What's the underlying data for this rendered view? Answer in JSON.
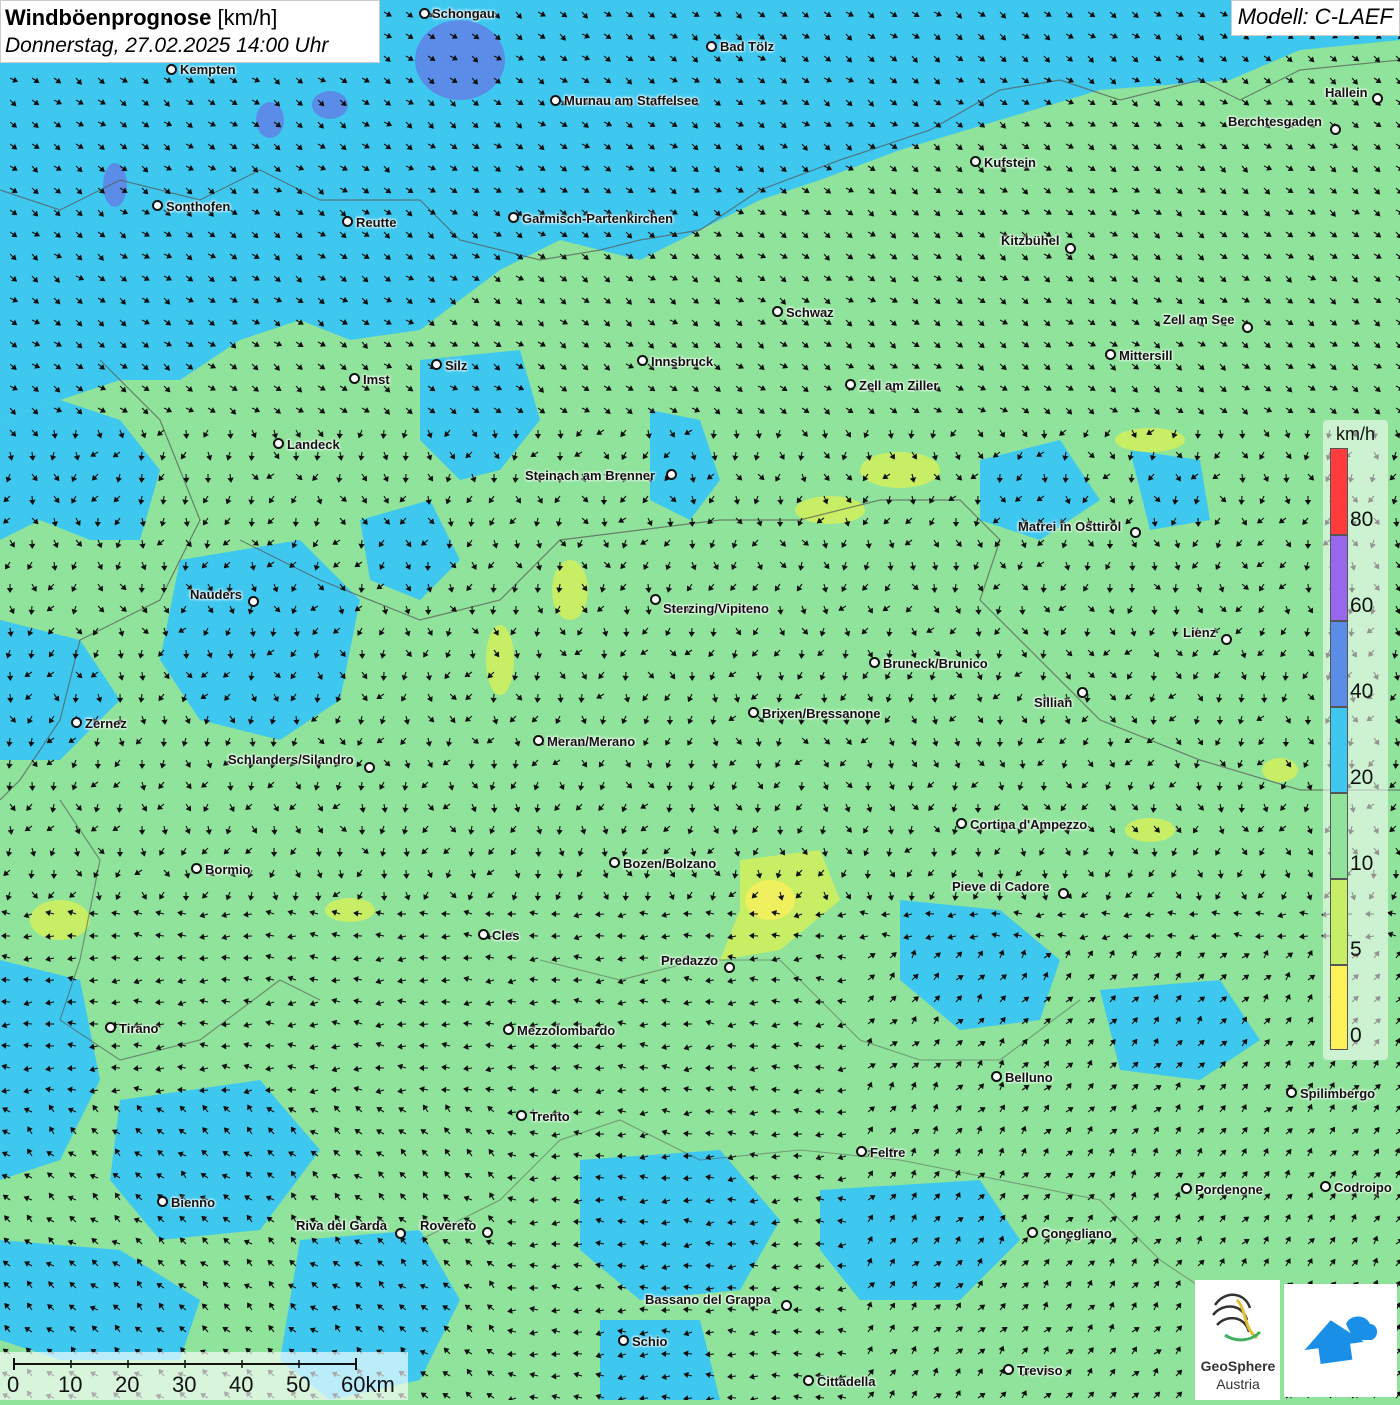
{
  "title": {
    "main": "Windböenprognose",
    "unit": "[km/h]",
    "date": "Donnerstag, 27.02.2025 14:00 Uhr"
  },
  "model": "Modell: C-LAEF",
  "legend": {
    "unit": "km/h",
    "labels": [
      "80",
      "60",
      "40",
      "20",
      "10",
      "5",
      "0"
    ],
    "colors": {
      "c80": "#ff3b3b",
      "c60": "#9966ee",
      "c40": "#5b8de8",
      "c20": "#3ec8f0",
      "c10": "#8fe39a",
      "c5": "#c8ee66",
      "c0": "#fff15a"
    }
  },
  "scale": {
    "labels": [
      "0",
      "10",
      "20",
      "30",
      "40",
      "50",
      "60km"
    ]
  },
  "logos": {
    "geosphere_line1": "GeoSphere",
    "geosphere_line2": "Austria"
  },
  "cities": [
    {
      "name": "Schongau"
    },
    {
      "name": "Bad Tölz"
    },
    {
      "name": "Kempten"
    },
    {
      "name": "Murnau am Staffelsee"
    },
    {
      "name": "Hallein"
    },
    {
      "name": "Berchtesgaden"
    },
    {
      "name": "Kufstein"
    },
    {
      "name": "Sonthofen"
    },
    {
      "name": "Reutte"
    },
    {
      "name": "Garmisch-Partenkirchen"
    },
    {
      "name": "Kitzbühel"
    },
    {
      "name": "Schwaz"
    },
    {
      "name": "Zell am See"
    },
    {
      "name": "Mittersill"
    },
    {
      "name": "Innsbruck"
    },
    {
      "name": "Imst"
    },
    {
      "name": "Silz"
    },
    {
      "name": "Zell am Ziller"
    },
    {
      "name": "Landeck"
    },
    {
      "name": "Steinach am Brenner"
    },
    {
      "name": "Matrei in Osttirol"
    },
    {
      "name": "Nauders"
    },
    {
      "name": "Sterzing/Vipiteno"
    },
    {
      "name": "Lienz"
    },
    {
      "name": "Bruneck/Brunico"
    },
    {
      "name": "Sillian"
    },
    {
      "name": "Zernez"
    },
    {
      "name": "Brixen/Bressanone"
    },
    {
      "name": "Meran/Merano"
    },
    {
      "name": "Schlanders/Silandro"
    },
    {
      "name": "Cortina d'Ampezzo"
    },
    {
      "name": "Bormio"
    },
    {
      "name": "Bozen/Bolzano"
    },
    {
      "name": "Pieve di Cadore"
    },
    {
      "name": "Cles"
    },
    {
      "name": "Predazzo"
    },
    {
      "name": "Tirano"
    },
    {
      "name": "Mezzolombardo"
    },
    {
      "name": "Belluno"
    },
    {
      "name": "Spilimbergo"
    },
    {
      "name": "Trento"
    },
    {
      "name": "Feltre"
    },
    {
      "name": "Pordenone"
    },
    {
      "name": "Codroipo"
    },
    {
      "name": "Bienno"
    },
    {
      "name": "Riva del Garda"
    },
    {
      "name": "Rovereto"
    },
    {
      "name": "Conegliano"
    },
    {
      "name": "Bassano del Grappa"
    },
    {
      "name": "Schio"
    },
    {
      "name": "Treviso"
    },
    {
      "name": "Cittadella"
    }
  ]
}
